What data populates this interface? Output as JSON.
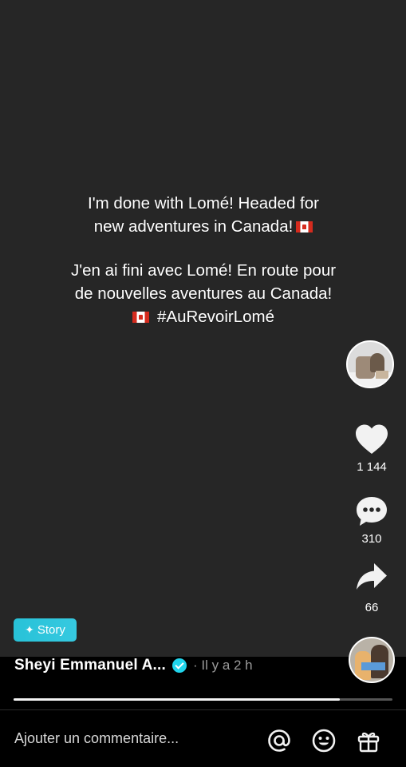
{
  "post": {
    "line1": "I'm done with Lomé!   Headed for",
    "line2": "new adventures in Canada!",
    "line3": "J'en ai fini avec Lomé!   En route pour",
    "line4": "de nouvelles aventures au Canada!",
    "line5": "#AuRevoirLomé"
  },
  "actions": {
    "likes": "1 144",
    "comments": "310",
    "shares": "66"
  },
  "story_badge": {
    "star": "✦",
    "label": "Story"
  },
  "author": {
    "name": "Sheyi Emmanuel A...",
    "time": "· Il y a 2 h"
  },
  "progress": {
    "fraction": 0.86
  },
  "comment": {
    "placeholder": "Ajouter un commentaire..."
  },
  "icons": {
    "like": "heart-icon",
    "comment": "comment-bubble-icon",
    "share": "share-arrow-icon",
    "mention": "at-icon",
    "emoji": "emoji-icon",
    "gift": "gift-icon",
    "verified": "verified-badge-icon"
  },
  "colors": {
    "background": "#262626",
    "badge": "#28c2d8",
    "verified": "#20d5ec"
  }
}
